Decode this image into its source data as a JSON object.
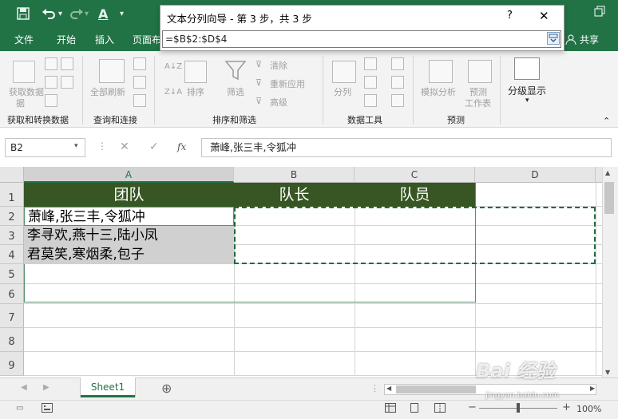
{
  "titlebar": {
    "save_icon": "save-icon",
    "undo_icon": "undo-icon",
    "redo_icon": "redo-icon",
    "font_color_glyph": "A",
    "dropdown_glyph": "▾"
  },
  "ribbon_tabs": {
    "file": "文件",
    "home": "开始",
    "insert": "插入",
    "page_layout": "页面布",
    "share": "共享"
  },
  "ribbon": {
    "get_data": "获取数据",
    "get_data_line2": "据",
    "refresh_all": "全部刷新",
    "sort": "排序",
    "filter": "筛选",
    "clear": "清除",
    "reapply": "重新应用",
    "advanced": "高级",
    "split": "分列",
    "whatif": "模拟分析",
    "forecast": "预测",
    "forecast_sheet_1": "预测",
    "forecast_sheet_2": "工作表",
    "outline": "分级显示",
    "groups": {
      "get_transform": "获取和转换数据",
      "queries": "查询和连接",
      "sort_filter": "排序和筛选",
      "data_tools": "数据工具",
      "forecast": "预测"
    }
  },
  "dialog": {
    "title": "文本分列向导 - 第 3 步，共 3 步",
    "help": "?",
    "close": "✕",
    "input_value": "=$B$2:$D$4"
  },
  "formula_bar": {
    "name_box": "B2",
    "fx": "fx",
    "cancel": "✕",
    "enter": "✓",
    "content": "萧峰,张三丰,令狐冲"
  },
  "grid": {
    "columns": [
      "A",
      "B",
      "C",
      "D"
    ],
    "rows": [
      "1",
      "2",
      "3",
      "4",
      "5",
      "6",
      "7",
      "8",
      "9"
    ],
    "header_row": [
      "团队",
      "队长",
      "队员"
    ],
    "data_rows": [
      "萧峰,张三丰,令狐冲",
      "李寻欢,燕十三,陆小凤",
      "君莫笑,寒烟柔,包子"
    ]
  },
  "sheets": {
    "tabs": [
      "Sheet1"
    ],
    "add": "⊕"
  },
  "status": {
    "zoom": "100%",
    "minus": "−",
    "plus": "+"
  },
  "colors": {
    "excel_green": "#217346",
    "header_fill": "#375623",
    "selected_gray": "#d0d0d0"
  },
  "watermark": {
    "text": "Bai 经验",
    "sub": "jingyan.baidu.com"
  }
}
